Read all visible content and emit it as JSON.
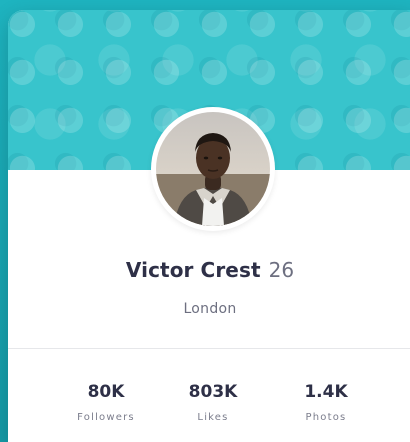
{
  "profile": {
    "name": "Victor Crest",
    "age": "26",
    "city": "London",
    "avatar_icon": "person-photo",
    "cover_pattern": "bubble-pattern",
    "colors": {
      "cover": "#38c4cc",
      "background": "#19a2ae",
      "text_dark": "#2e3047",
      "text_muted": "#6d6f80"
    }
  },
  "stats": [
    {
      "value": "80K",
      "label": "Followers"
    },
    {
      "value": "803K",
      "label": "Likes"
    },
    {
      "value": "1.4K",
      "label": "Photos"
    }
  ]
}
